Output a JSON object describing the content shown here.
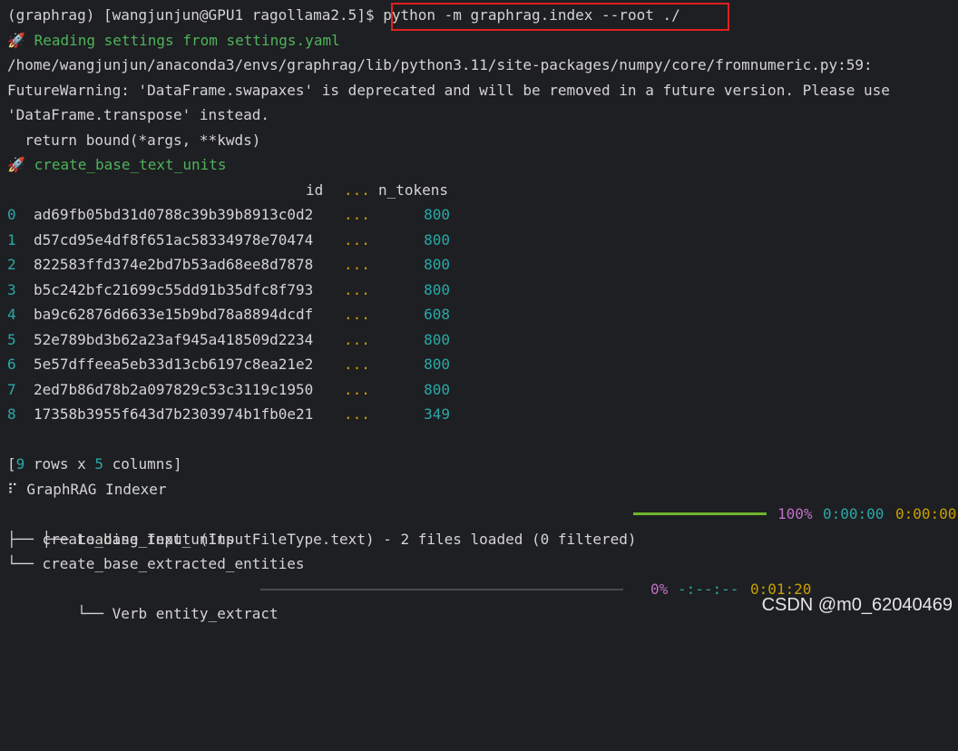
{
  "prompt": "(graphrag) [wangjunjun@GPU1 ragollama2.5]$ ",
  "command": "python -m graphrag.index --root ./",
  "rocket_glyph": "🚀",
  "reading_msg": "Reading settings from settings.yaml",
  "warning_path": "/home/wangjunjun/anaconda3/envs/graphrag/lib/python3.11/site-packages/numpy/core/fromnumeric.py:59:",
  "warning_line2": "FutureWarning: 'DataFrame.swapaxes' is deprecated and will be removed in a future version. Please use",
  "warning_line3": "'DataFrame.transpose' instead.",
  "warning_line4": "  return bound(*args, **kwds)",
  "workflow_name": "create_base_text_units",
  "table": {
    "header_id": "id",
    "header_dots": "...",
    "header_ntokens": "n_tokens",
    "rows": [
      {
        "idx": "0",
        "id": "ad69fb05bd31d0788c39b39b8913c0d2",
        "dots": "...",
        "n_tokens": "800"
      },
      {
        "idx": "1",
        "id": "d57cd95e4df8f651ac58334978e70474",
        "dots": "...",
        "n_tokens": "800"
      },
      {
        "idx": "2",
        "id": "822583ffd374e2bd7b53ad68ee8d7878",
        "dots": "...",
        "n_tokens": "800"
      },
      {
        "idx": "3",
        "id": "b5c242bfc21699c55dd91b35dfc8f793",
        "dots": "...",
        "n_tokens": "800"
      },
      {
        "idx": "4",
        "id": "ba9c62876d6633e15b9bd78a8894dcdf",
        "dots": "...",
        "n_tokens": "608"
      },
      {
        "idx": "5",
        "id": "52e789bd3b62a23af945a418509d2234",
        "dots": "...",
        "n_tokens": "800"
      },
      {
        "idx": "6",
        "id": "5e57dffeea5eb33d13cb6197c8ea21e2",
        "dots": "...",
        "n_tokens": "800"
      },
      {
        "idx": "7",
        "id": "2ed7b86d78b2a097829c53c3119c1950",
        "dots": "...",
        "n_tokens": "800"
      },
      {
        "idx": "8",
        "id": "17358b3955f643d7b2303974b1fb0e21",
        "dots": "...",
        "n_tokens": "349"
      }
    ],
    "summary_open": "[",
    "summary_rows": "9",
    "summary_mid": " rows x ",
    "summary_cols": "5",
    "summary_close": " columns]"
  },
  "indexer": {
    "title_glyph": "⠏",
    "title": "GraphRAG Indexer",
    "tree": [
      {
        "branch": "├── ",
        "label": "Loading Input (InputFileType.text) - 2 files loaded (0 filtered)"
      },
      {
        "branch": "├── ",
        "label": "create_base_text_units"
      },
      {
        "branch": "└── ",
        "label": "create_base_extracted_entities"
      }
    ],
    "loading_progress": {
      "percent": "100%",
      "elapsed": "0:00:00",
      "remaining": "0:00:00",
      "fraction": 1.0
    },
    "verb": {
      "branch": "    └── ",
      "label": "Verb entity_extract",
      "percent": "0%",
      "eta": "-:--:--",
      "elapsed": "0:01:20",
      "fraction": 0.0
    }
  },
  "watermark": "CSDN @m0_62040469",
  "colors": {
    "background": "#1e1f22",
    "text": "#d4d4d4",
    "green": "#4eb35a",
    "cyan": "#2aa8a8",
    "orange": "#c8a000",
    "magenta": "#c070c8",
    "highlight_box": "#e02020",
    "progress_done": "#6fb52c"
  }
}
